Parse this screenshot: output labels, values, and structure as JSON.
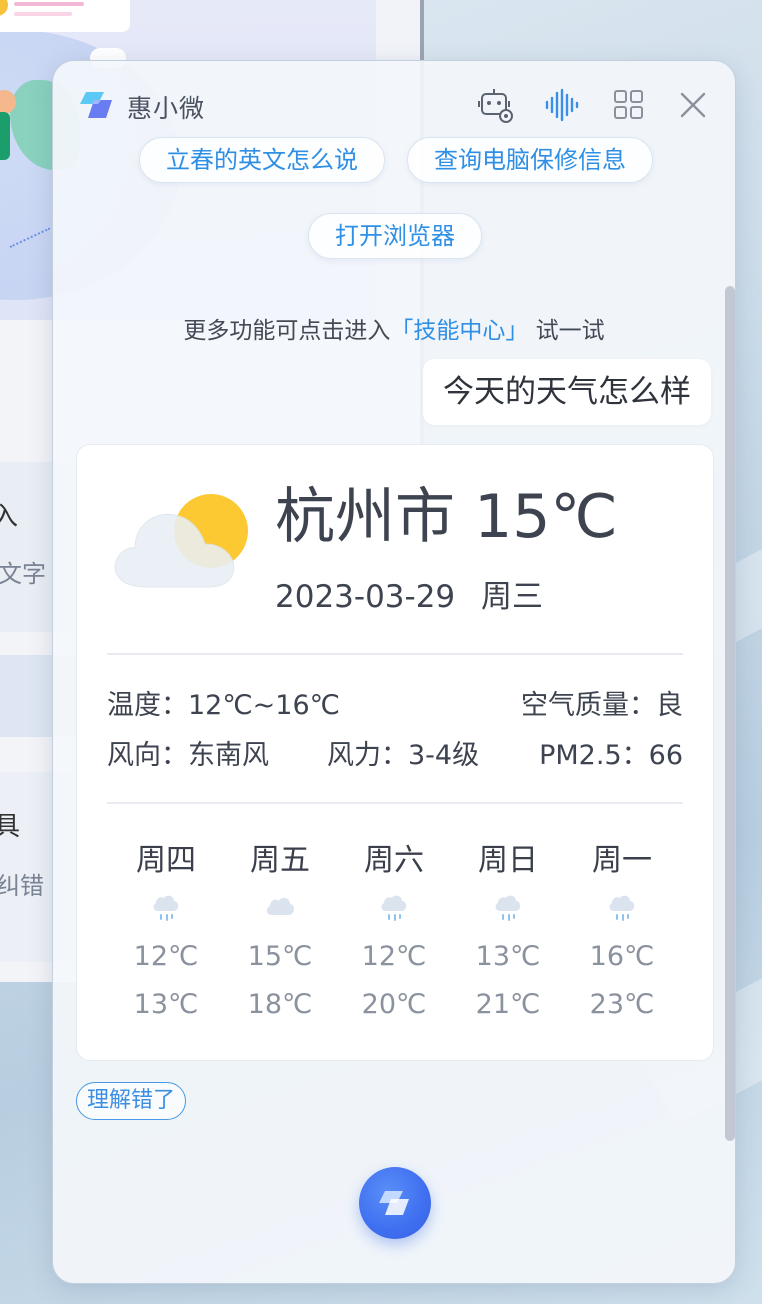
{
  "background": {
    "fragments": [
      "入",
      "文字",
      "具",
      "纠错"
    ]
  },
  "header": {
    "title": "惠小微",
    "icons": [
      "robot-settings-icon",
      "voice-wave-icon",
      "grid-apps-icon",
      "close-icon"
    ]
  },
  "suggestions": [
    "立春的英文怎么说",
    "查询电脑保修信息",
    "打开浏览器"
  ],
  "hint": {
    "before": "更多功能可点击进入",
    "link": "「技能中心」",
    "after": "试一试"
  },
  "user_message": "今天的天气怎么样",
  "weather": {
    "city_temp": "杭州市 15℃",
    "date": "2023-03-29",
    "weekday": "周三",
    "current_icon": "partly-cloudy-icon",
    "temperature_label": "温度：",
    "temperature_value": "12℃~16℃",
    "air_quality_label": "空气质量：",
    "air_quality_value": "良",
    "wind_direction_label": "风向：",
    "wind_direction_value": "东南风",
    "wind_force_label": "风力：",
    "wind_force_value": "3-4级",
    "pm25_label": "PM2.5：",
    "pm25_value": "66",
    "forecast": [
      {
        "day": "周四",
        "icon": "light-rain-icon",
        "low": "12℃",
        "high": "13℃"
      },
      {
        "day": "周五",
        "icon": "cloudy-icon",
        "low": "15℃",
        "high": "18℃"
      },
      {
        "day": "周六",
        "icon": "light-rain-icon",
        "low": "12℃",
        "high": "20℃"
      },
      {
        "day": "周日",
        "icon": "light-rain-icon",
        "low": "13℃",
        "high": "21℃"
      },
      {
        "day": "周一",
        "icon": "light-rain-icon",
        "low": "16℃",
        "high": "23℃"
      }
    ]
  },
  "feedback_label": "理解错了",
  "colors": {
    "accent": "#2f8fe5",
    "fab": "#3f6ff0",
    "sun": "#fcc933",
    "text": "#3e4350"
  }
}
